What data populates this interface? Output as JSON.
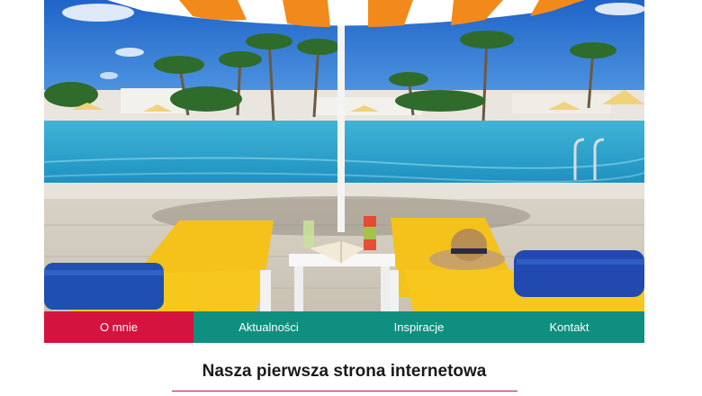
{
  "nav": {
    "items": [
      {
        "label": "O mnie",
        "active": true
      },
      {
        "label": "Aktualności",
        "active": false
      },
      {
        "label": "Inspiracje",
        "active": false
      },
      {
        "label": "Kontakt",
        "active": false
      }
    ]
  },
  "main": {
    "title": "Nasza pierwsza strona internetowa"
  },
  "colors": {
    "nav_active": "#d4143f",
    "nav_background": "#0f8f7f",
    "title_rule": "#c4103c"
  }
}
